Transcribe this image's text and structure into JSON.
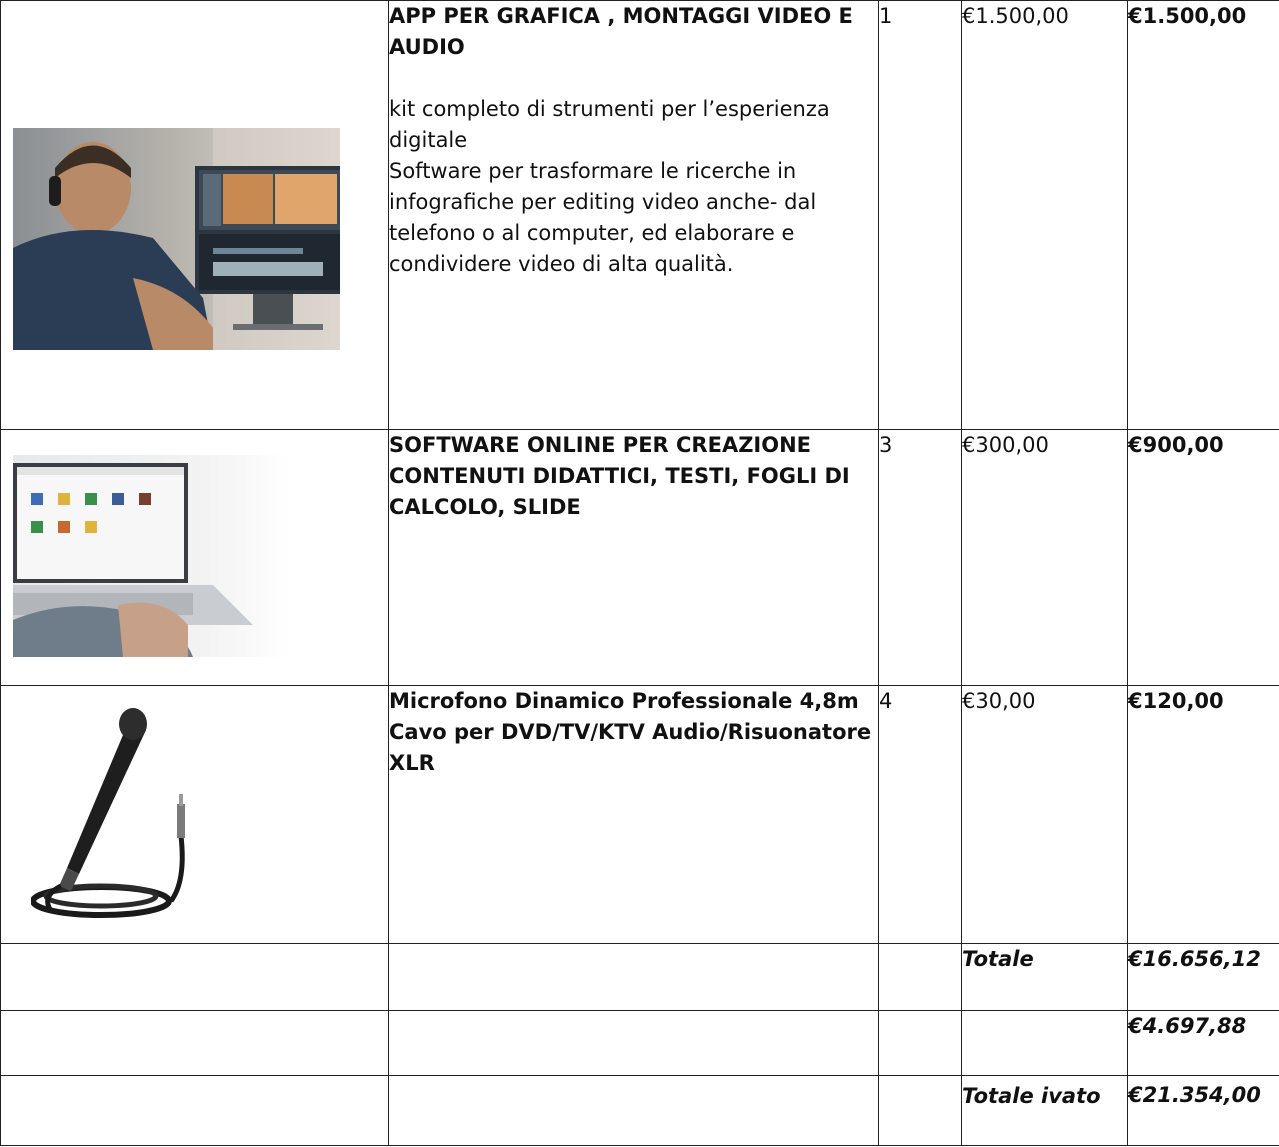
{
  "items": [
    {
      "title": "APP PER GRAFICA , MONTAGGI VIDEO E AUDIO",
      "body": [
        "kit completo di strumenti per l’esperienza digitale",
        "Software per trasformare le ricerche in infografiche  per editing video anche- dal telefono o al computer, ed elaborare e condividere video di alta qualità."
      ],
      "qty": "1",
      "unit_price": "€1.500,00",
      "total": "€1.500,00"
    },
    {
      "title": "SOFTWARE ONLINE PER CREAZIONE CONTENUTI DIDATTICI, TESTI, FOGLI DI CALCOLO, SLIDE",
      "qty": "3",
      "unit_price": "€300,00",
      "total": "€900,00"
    },
    {
      "title": "Microfono Dinamico Professionale 4,8m Cavo per DVD/TV/KTV Audio/Risuonatore XLR",
      "qty": "4",
      "unit_price": "€30,00",
      "total": "€120,00"
    }
  ],
  "summary": [
    {
      "label": "Totale",
      "value": "€16.656,12"
    },
    {
      "label": "",
      "value": "€4.697,88"
    },
    {
      "label": "Totale ivato",
      "value": "€21.354,00"
    }
  ]
}
